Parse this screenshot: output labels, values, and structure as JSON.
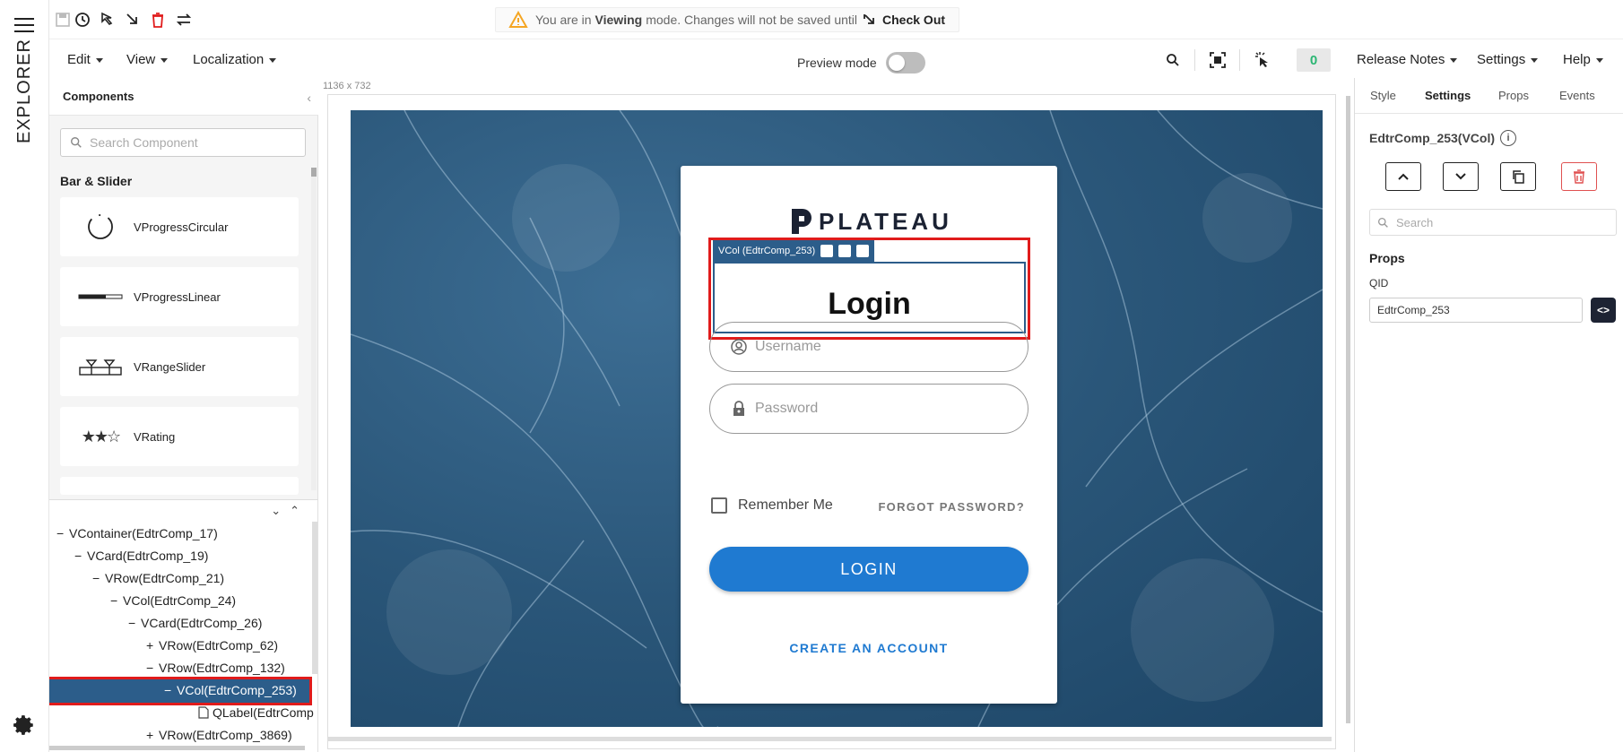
{
  "rail": {
    "label": "EXPLORER"
  },
  "notice": {
    "prefix": "You are in",
    "mode": "Viewing",
    "suffix": "mode. Changes will not be saved until",
    "action": "Check Out"
  },
  "menu": {
    "edit": "Edit",
    "view": "View",
    "localization": "Localization",
    "release_notes": "Release Notes",
    "settings": "Settings",
    "help": "Help"
  },
  "preview": {
    "label": "Preview mode",
    "on": false
  },
  "counter": "0",
  "components": {
    "title": "Components",
    "search_placeholder": "Search Component",
    "category": "Bar & Slider",
    "items": [
      "VProgressCircular",
      "VProgressLinear",
      "VRangeSlider",
      "VRating"
    ]
  },
  "tree": {
    "nodes": [
      {
        "mark": "−",
        "label": "VContainer(EdtrComp_17)"
      },
      {
        "mark": "−",
        "label": "VCard(EdtrComp_19)"
      },
      {
        "mark": "−",
        "label": "VRow(EdtrComp_21)"
      },
      {
        "mark": "−",
        "label": "VCol(EdtrComp_24)"
      },
      {
        "mark": "−",
        "label": "VCard(EdtrComp_26)"
      },
      {
        "mark": "+",
        "label": "VRow(EdtrComp_62)"
      },
      {
        "mark": "−",
        "label": "VRow(EdtrComp_132)"
      },
      {
        "mark": "−",
        "label": "VCol(EdtrComp_253)"
      },
      {
        "mark": "",
        "label": "QLabel(EdtrComp"
      },
      {
        "mark": "+",
        "label": "VRow(EdtrComp_3869)"
      }
    ]
  },
  "canvas": {
    "size_label": "1136 x 732",
    "brand": "PLATEAU",
    "chip_label": "VCol (EdtrComp_253)",
    "heading": "Login",
    "username_placeholder": "Username",
    "password_placeholder": "Password",
    "remember": "Remember Me",
    "forgot": "FORGOT PASSWORD?",
    "login_button": "LOGIN",
    "create_account": "CREATE AN ACCOUNT"
  },
  "inspector": {
    "tabs": [
      "Style",
      "Settings",
      "Props",
      "Events"
    ],
    "active_tab": "Settings",
    "title": "EdtrComp_253(VCol)",
    "search_placeholder": "Search",
    "section": "Props",
    "qid_label": "QID",
    "qid_value": "EdtrComp_253",
    "code_button": "<>"
  },
  "colors": {
    "accent": "#1f7ad1",
    "selection": "#2c5d8a",
    "highlight": "#e01b1b",
    "counter": "#2bb673"
  }
}
